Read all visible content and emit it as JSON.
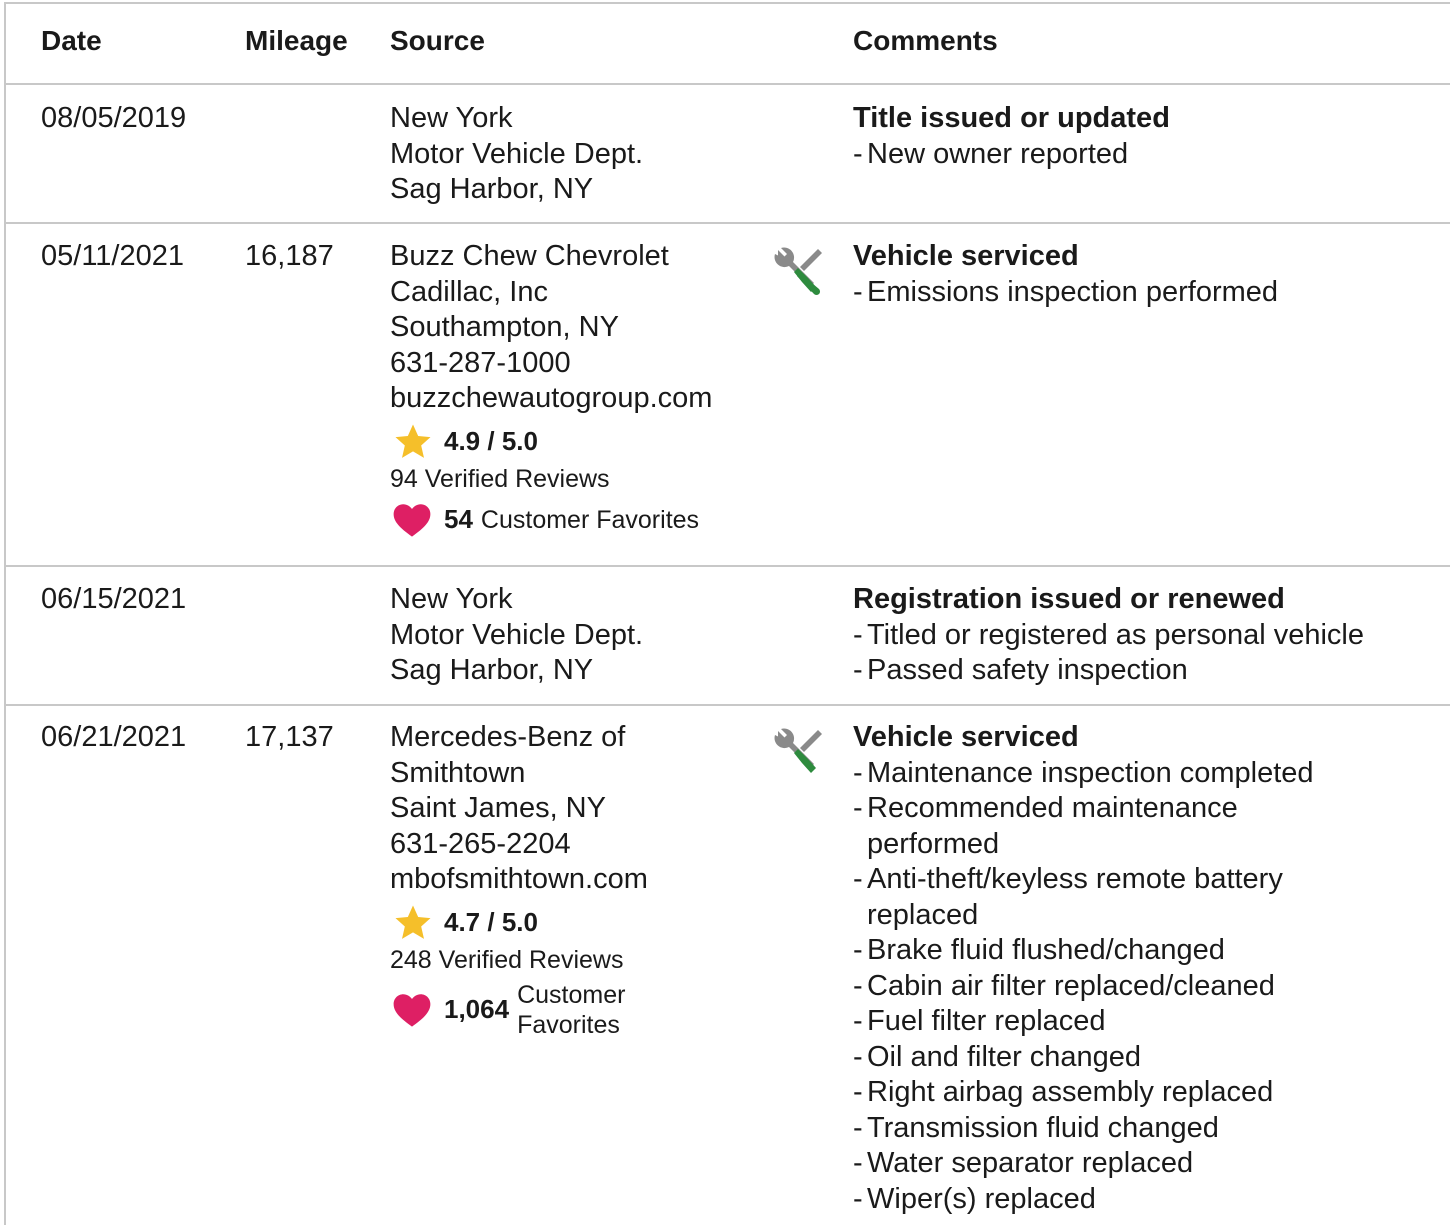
{
  "header": {
    "date": "Date",
    "mileage": "Mileage",
    "source": "Source",
    "comments": "Comments"
  },
  "colors": {
    "border": "#c8c8c8",
    "star": "#f5bf2a",
    "heart": "#de1f64",
    "wrench_gray": "#8a8a8a",
    "screwdriver_green": "#2e8b3e"
  },
  "records": [
    {
      "date": "08/05/2019",
      "mileage": "",
      "source": [
        "New York",
        "Motor Vehicle Dept.",
        "Sag Harbor, NY"
      ],
      "title": "Title issued or updated",
      "items": [
        "New owner reported"
      ]
    },
    {
      "date": "05/11/2021",
      "mileage": "16,187",
      "icon": "service-tools-icon",
      "source": [
        "Buzz Chew Chevrolet",
        "Cadillac, Inc",
        "Southampton, NY",
        "631-287-1000",
        "buzzchewautogroup.com"
      ],
      "rating": "4.9 / 5.0",
      "reviews": "94 Verified Reviews",
      "favorites_count": "54",
      "favorites_label": "Customer Favorites",
      "title": "Vehicle serviced",
      "items": [
        "Emissions inspection performed"
      ]
    },
    {
      "date": "06/15/2021",
      "mileage": "",
      "source": [
        "New York",
        "Motor Vehicle Dept.",
        "Sag Harbor, NY"
      ],
      "title": "Registration issued or renewed",
      "items": [
        "Titled or registered as personal vehicle",
        "Passed safety inspection"
      ]
    },
    {
      "date": "06/21/2021",
      "mileage": "17,137",
      "icon": "service-tools-icon",
      "source": [
        "Mercedes-Benz of",
        "Smithtown",
        "Saint James, NY",
        "631-265-2204",
        "mbofsmithtown.com"
      ],
      "rating": "4.7 / 5.0",
      "reviews": "248 Verified Reviews",
      "favorites_count": "1,064",
      "favorites_label": "Customer Favorites",
      "title": "Vehicle serviced",
      "items": [
        "Maintenance inspection completed",
        "Recommended maintenance performed",
        "Anti-theft/keyless remote battery replaced",
        "Brake fluid flushed/changed",
        "Cabin air filter replaced/cleaned",
        "Fuel filter replaced",
        "Oil and filter changed",
        "Right airbag assembly replaced",
        "Transmission fluid changed",
        "Water separator replaced",
        "Wiper(s) replaced"
      ]
    }
  ]
}
